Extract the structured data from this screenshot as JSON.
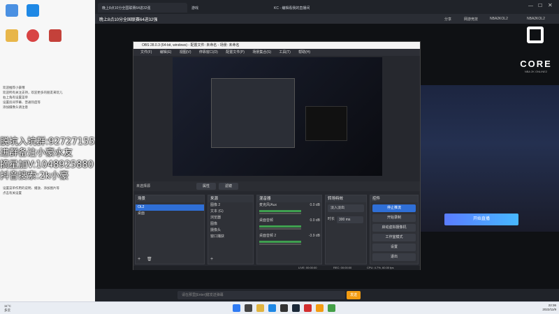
{
  "desktop": {
    "promo_lines": [
      "脱坑入坑群:927271553",
      "进群备注小豪水友",
      "摘星加V:1048925880",
      "抖音搜索:2k小豪"
    ],
    "notes_top": "欢迎推荐小豪哦\n欢迎所有关注支持，欢迎更多的朋友来玩儿\n右上角有设置菜单\n设置房间字幕、普通热度等\n添加摄像头请注意",
    "notes_bottom": "设置菜单作用的说明、播放、添加图片等\n点击有关设置"
  },
  "browser": {
    "tabs": [
      "晚上8点10分全国联赛64进32强",
      "游戏",
      "KC - 编辑看我的直播间"
    ],
    "room_title": "晚上8点10分全国联赛64进32强",
    "header_right": [
      "分享",
      "网游竞技",
      "NBA2KOL2",
      "NBA2KOL2"
    ],
    "start_button": "开始直播",
    "chat_placeholder": "请在那里[Enter]键发送弹幕",
    "send_button": "发送",
    "gift_label": "开始直播"
  },
  "core_logo": {
    "text": "CORE",
    "sub": "NBA 2K ONLINE2"
  },
  "obs": {
    "title": "OBS 28.0.3 (64-bit, windows) - 配置文件: 未命名 - 场景: 未命名",
    "menu": [
      "文件(F)",
      "编辑(E)",
      "视图(V)",
      "停靠窗口(D)",
      "配置文件(P)",
      "场景集合(S)",
      "工具(T)",
      "帮助(H)"
    ],
    "no_source": "未选择源",
    "props_button": "属性",
    "filters_button": "滤镜",
    "scenes": {
      "title": "场景",
      "items": [
        "OL2",
        "桌面"
      ]
    },
    "sources": {
      "title": "来源",
      "items": [
        "图像 2",
        "文本 (G)",
        "浏览器",
        "图像",
        "摄像头",
        "窗口捕获"
      ]
    },
    "mixer": {
      "title": "混音器",
      "channels": [
        {
          "name": "麦克风/Aux",
          "db": "0.0 dB"
        },
        {
          "name": "桌面音频",
          "db": "0.0 dB"
        },
        {
          "name": "桌面音频 2",
          "db": "-3.9 dB"
        }
      ]
    },
    "transitions": {
      "title": "转场特效",
      "type": "淡入淡出",
      "duration_label": "时长",
      "duration": "300 ms"
    },
    "controls": {
      "title": "控件",
      "buttons": [
        "停止推流",
        "开始录制",
        "启动虚拟摄像机",
        "工作室模式",
        "设置",
        "退出"
      ]
    },
    "status": {
      "live": "LIVE: 00:00:00",
      "rec": "REC: 00:00:00",
      "cpu": "CPU: 4.7%, 60.00 fps"
    }
  },
  "taskbar": {
    "weather_temp": "11°C",
    "weather_desc": "多云",
    "time": "22:36",
    "date": "2022/11/9"
  },
  "colors": {
    "accent_blue": "#2f7bf3",
    "obs_bg": "#26282e",
    "start_btn": "#47b8ff"
  }
}
